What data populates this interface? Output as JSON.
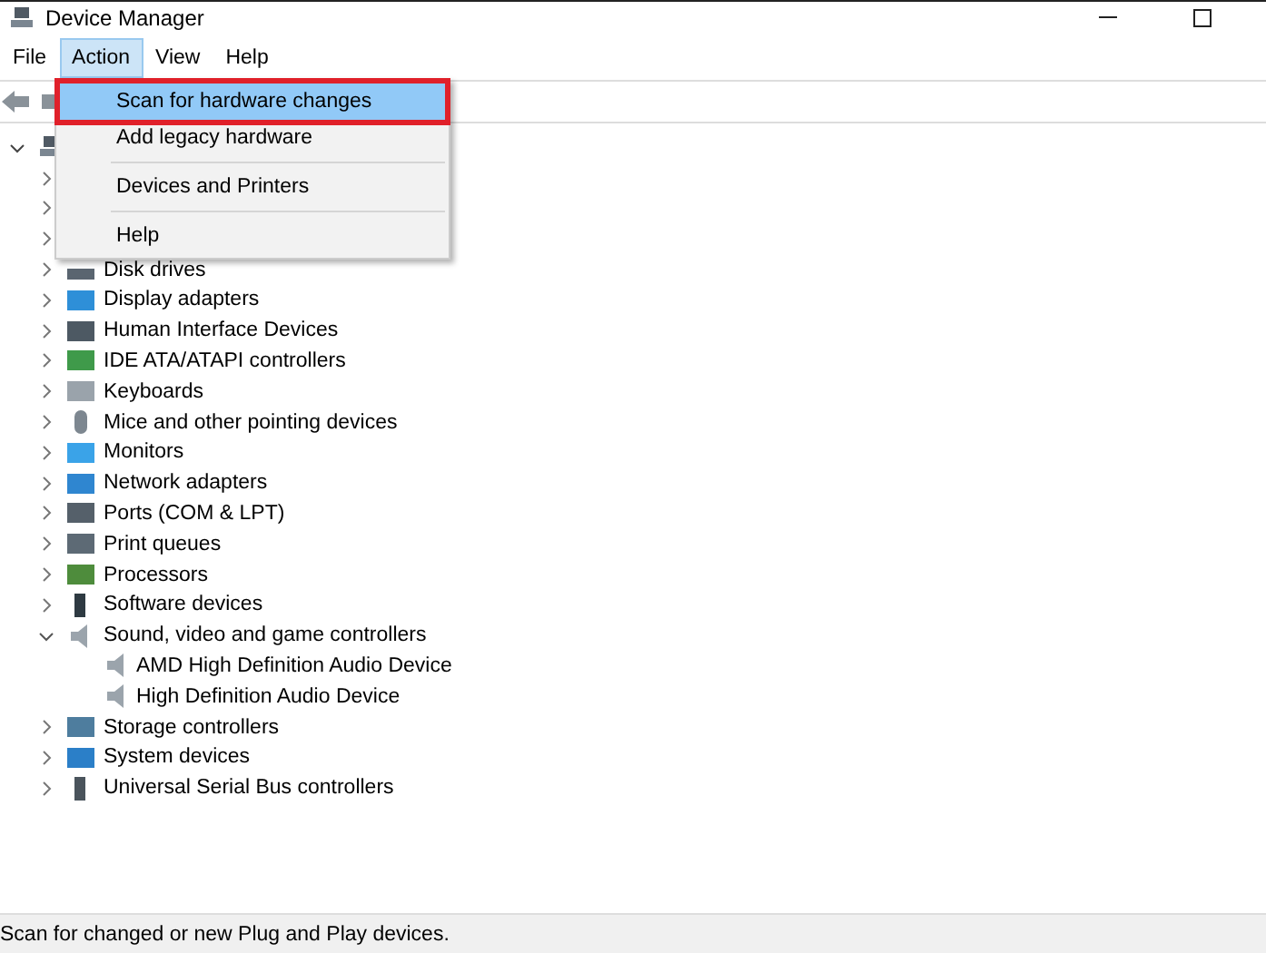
{
  "window": {
    "title": "Device Manager"
  },
  "menu_bar": [
    {
      "label": "File",
      "selected": false
    },
    {
      "label": "Action",
      "selected": true
    },
    {
      "label": "View",
      "selected": false
    },
    {
      "label": "Help",
      "selected": false
    }
  ],
  "action_menu": [
    {
      "kind": "item",
      "label": "Scan for hardware changes",
      "selected": true,
      "marked": true
    },
    {
      "kind": "item",
      "label": "Add legacy hardware",
      "selected": false,
      "marked": false
    },
    {
      "kind": "separator"
    },
    {
      "kind": "item",
      "label": "Devices and Printers",
      "selected": false,
      "marked": false
    },
    {
      "kind": "separator"
    },
    {
      "kind": "item",
      "label": "Help",
      "selected": false,
      "marked": false
    }
  ],
  "tree": {
    "expanded": true,
    "children": [
      {
        "expanded": false
      },
      {
        "expanded": false
      },
      {
        "expanded": false
      },
      {
        "label": "Disk drives",
        "expanded": false
      },
      {
        "label": "Display adapters",
        "expanded": false
      },
      {
        "label": "Human Interface Devices",
        "expanded": false
      },
      {
        "label": "IDE ATA/ATAPI controllers",
        "expanded": false
      },
      {
        "label": "Keyboards",
        "expanded": false
      },
      {
        "label": "Mice and other pointing devices",
        "expanded": false
      },
      {
        "label": "Monitors",
        "expanded": false
      },
      {
        "label": "Network adapters",
        "expanded": false
      },
      {
        "label": "Ports (COM & LPT)",
        "expanded": false
      },
      {
        "label": "Print queues",
        "expanded": false
      },
      {
        "label": "Processors",
        "expanded": false
      },
      {
        "label": "Software devices",
        "expanded": false
      },
      {
        "label": "Sound, video and game controllers",
        "expanded": true,
        "children": [
          {
            "label": "AMD High Definition Audio Device"
          },
          {
            "label": "High Definition Audio Device"
          }
        ]
      },
      {
        "label": "Storage controllers",
        "expanded": false
      },
      {
        "label": "System devices",
        "expanded": false
      },
      {
        "label": "Universal Serial Bus controllers",
        "expanded": false
      }
    ]
  },
  "status_bar": "Scan for changed or new Plug and Play devices."
}
